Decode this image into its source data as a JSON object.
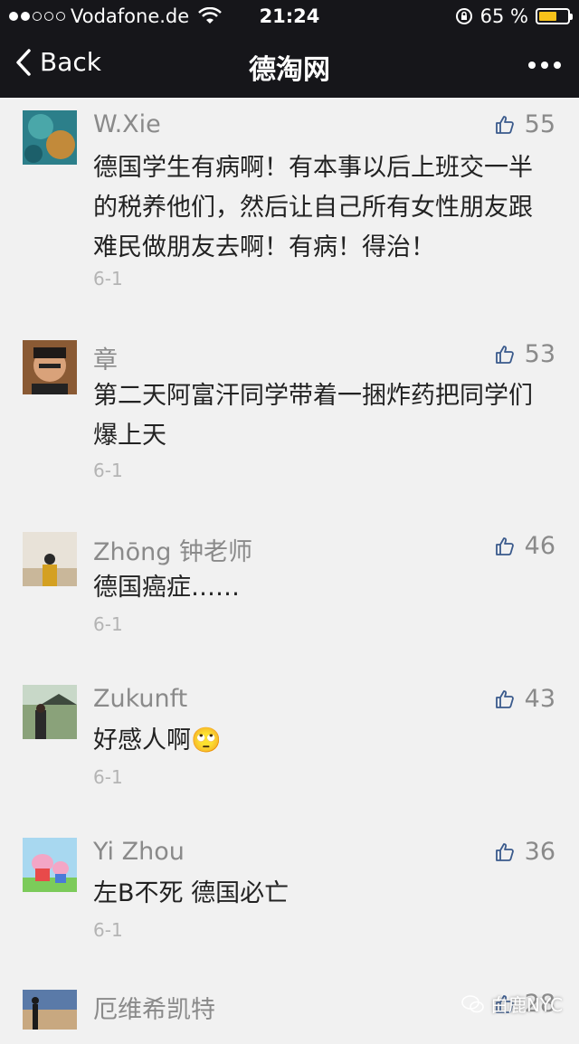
{
  "status_bar": {
    "carrier": "Vodafone.de",
    "time": "21:24",
    "battery_percent": "65 %",
    "signal_bars_filled": 2,
    "signal_bars_total": 5,
    "battery_level": 0.65
  },
  "nav": {
    "back_label": "Back",
    "title": "德淘网"
  },
  "comments": [
    {
      "name": "W.Xie",
      "likes": "55",
      "text": "德国学生有病啊！有本事以后上班交一半的税养他们，然后让自己所有女性朋友跟难民做朋友去啊！有病！得治！",
      "date": "6-1"
    },
    {
      "name": "章",
      "likes": "53",
      "text": "第二天阿富汗同学带着一捆炸药把同学们爆上天",
      "date": "6-1"
    },
    {
      "name": "Zhōng 钟老师",
      "likes": "46",
      "text": "德国癌症……",
      "date": "6-1"
    },
    {
      "name": "Zukunft",
      "likes": "43",
      "text": "好感人啊🙄",
      "date": "6-1"
    },
    {
      "name": "Yi Zhou",
      "likes": "36",
      "text": "左B不死 德国必亡",
      "date": "6-1"
    },
    {
      "name": "厄维希凯特",
      "likes": "28",
      "text": "",
      "date": ""
    }
  ],
  "watermark": "白鹿NYC",
  "colors": {
    "bar_bg": "#16161a",
    "page_bg": "#f1f1f1",
    "battery": "#f7c21a"
  }
}
